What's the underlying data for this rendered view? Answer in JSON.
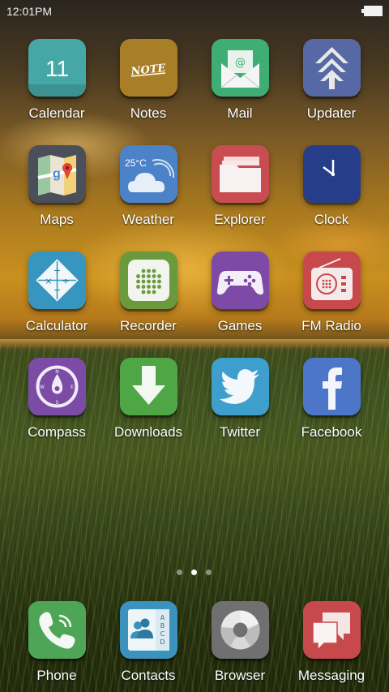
{
  "status_bar": {
    "time": "12:01PM"
  },
  "apps": [
    {
      "label": "Calendar",
      "date": "11",
      "color": "#45a7a6"
    },
    {
      "label": "Notes",
      "note_text": "NOTE",
      "color": "#a87e26"
    },
    {
      "label": "Mail",
      "color": "#3fae74"
    },
    {
      "label": "Updater",
      "color": "#5769a4"
    },
    {
      "label": "Maps",
      "color": "#4a4f5a"
    },
    {
      "label": "Weather",
      "temperature": "25°C",
      "color": "#4b82c8"
    },
    {
      "label": "Explorer",
      "color": "#c94c50"
    },
    {
      "label": "Clock",
      "color": "#263e8a"
    },
    {
      "label": "Calculator",
      "color": "#3796c0"
    },
    {
      "label": "Recorder",
      "color": "#6b9a3d"
    },
    {
      "label": "Games",
      "color": "#7d4aa8"
    },
    {
      "label": "FM Radio",
      "color": "#c8494c"
    },
    {
      "label": "Compass",
      "color": "#7b4ba6"
    },
    {
      "label": "Downloads",
      "color": "#4ea645"
    },
    {
      "label": "Twitter",
      "color": "#3f9fcc"
    },
    {
      "label": "Facebook",
      "color": "#4d76c8"
    }
  ],
  "page_indicator": {
    "pages": 3,
    "current": 2
  },
  "dock": [
    {
      "label": "Phone",
      "color": "#4ea557"
    },
    {
      "label": "Contacts",
      "letters": [
        "A",
        "B",
        "C",
        "D"
      ],
      "color": "#3b93bd"
    },
    {
      "label": "Browser",
      "color": "#707070"
    },
    {
      "label": "Messaging",
      "color": "#c8494c"
    }
  ]
}
